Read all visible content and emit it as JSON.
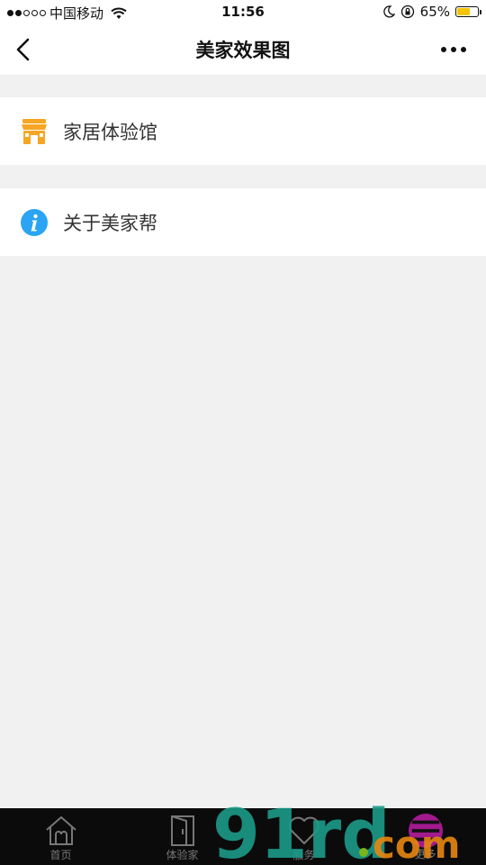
{
  "status_bar": {
    "carrier": "中国移动",
    "time": "11:56",
    "battery": "65%",
    "battery_level": 0.65,
    "icons": [
      "signal-dots",
      "wifi-icon",
      "moon-icon",
      "rotation-lock-icon",
      "battery-icon"
    ]
  },
  "nav": {
    "title": "美家效果图",
    "back_icon": "chevron-left-icon",
    "more_icon": "more-dots-icon"
  },
  "list": [
    {
      "label": "家居体验馆",
      "icon": "store-icon",
      "color": "#f6a623"
    },
    {
      "label": "关于美家帮",
      "icon": "info-icon",
      "color": "#2aa4f4"
    }
  ],
  "tabs": [
    {
      "label": "首页",
      "icon": "home-icon"
    },
    {
      "label": "体验家",
      "icon": "door-icon"
    },
    {
      "label": "服务",
      "icon": "heart-icon"
    },
    {
      "label": "更多",
      "icon": "menu-icon"
    }
  ],
  "watermark": {
    "text": "91rd.com"
  },
  "colors": {
    "background": "#f1f1f1",
    "tab_bar": "#0b0b0b",
    "more_accent": "#a21a8e",
    "battery": "#f5c400"
  }
}
